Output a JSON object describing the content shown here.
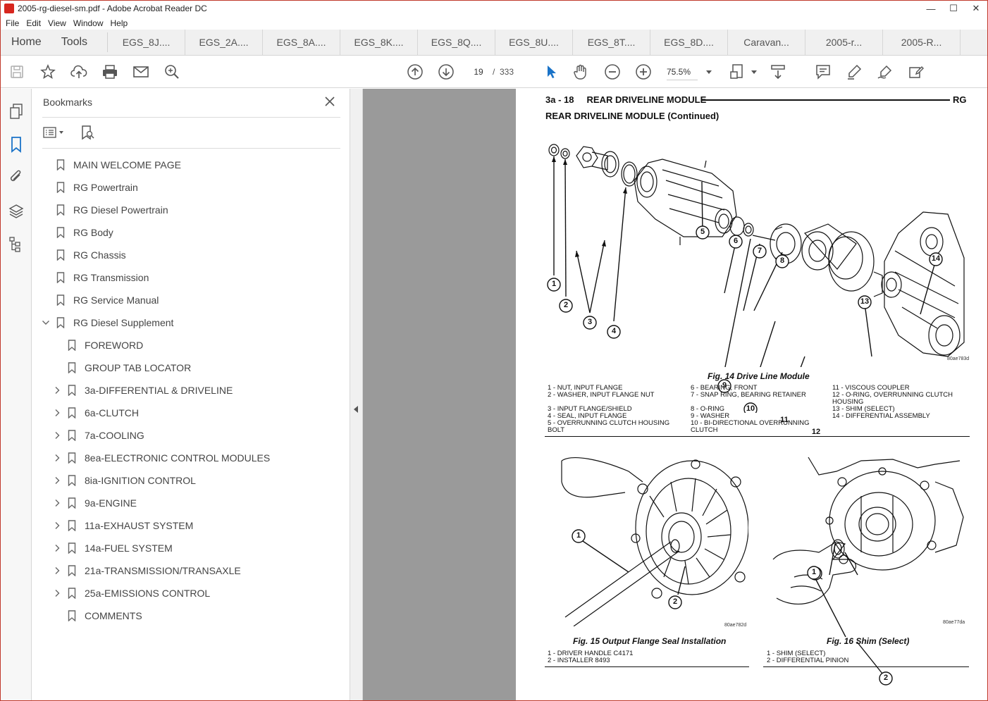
{
  "window": {
    "title": "2005-rg-diesel-sm.pdf - Adobe Acrobat Reader DC",
    "controls": {
      "minimize": "—",
      "maximize": "☐",
      "close": "✕"
    }
  },
  "menu": [
    "File",
    "Edit",
    "View",
    "Window",
    "Help"
  ],
  "tabs": {
    "home": "Home",
    "tools": "Tools",
    "documents": [
      "EGS_8J....",
      "EGS_2A....",
      "EGS_8A....",
      "EGS_8K....",
      "EGS_8Q....",
      "EGS_8U....",
      "EGS_8T....",
      "EGS_8D....",
      "Caravan...",
      "2005-r...",
      "2005-R..."
    ]
  },
  "toolbar": {
    "page_current": "19",
    "page_sep": "/",
    "page_total": "333",
    "zoom": "75.5%"
  },
  "bookmarks": {
    "title": "Bookmarks",
    "items": [
      {
        "label": "MAIN WELCOME PAGE",
        "level": 0,
        "expander": ""
      },
      {
        "label": "RG Powertrain",
        "level": 0,
        "expander": ""
      },
      {
        "label": "RG Diesel Powertrain",
        "level": 0,
        "expander": ""
      },
      {
        "label": "RG Body",
        "level": 0,
        "expander": ""
      },
      {
        "label": "RG Chassis",
        "level": 0,
        "expander": ""
      },
      {
        "label": "RG Transmission",
        "level": 0,
        "expander": ""
      },
      {
        "label": "RG Service Manual",
        "level": 0,
        "expander": ""
      },
      {
        "label": "RG Diesel Supplement",
        "level": 0,
        "expander": "open"
      },
      {
        "label": "FOREWORD",
        "level": 1,
        "expander": ""
      },
      {
        "label": "GROUP TAB LOCATOR",
        "level": 1,
        "expander": ""
      },
      {
        "label": "3a-DIFFERENTIAL & DRIVELINE",
        "level": 1,
        "expander": "closed"
      },
      {
        "label": "6a-CLUTCH",
        "level": 1,
        "expander": "closed"
      },
      {
        "label": "7a-COOLING",
        "level": 1,
        "expander": "closed"
      },
      {
        "label": "8ea-ELECTRONIC CONTROL MODULES",
        "level": 1,
        "expander": "closed"
      },
      {
        "label": "8ia-IGNITION CONTROL",
        "level": 1,
        "expander": "closed"
      },
      {
        "label": "9a-ENGINE",
        "level": 1,
        "expander": "closed"
      },
      {
        "label": "11a-EXHAUST SYSTEM",
        "level": 1,
        "expander": "closed"
      },
      {
        "label": "14a-FUEL SYSTEM",
        "level": 1,
        "expander": "closed"
      },
      {
        "label": "21a-TRANSMISSION/TRANSAXLE",
        "level": 1,
        "expander": "closed"
      },
      {
        "label": "25a-EMISSIONS CONTROL",
        "level": 1,
        "expander": "closed"
      },
      {
        "label": "COMMENTS",
        "level": 1,
        "expander": ""
      }
    ]
  },
  "page": {
    "header_left": "3a - 18     REAR DRIVELINE MODULE",
    "header_right": "RG",
    "subtitle": "REAR DRIVELINE MODULE (Continued)",
    "fig14": {
      "caption": "Fig. 14 Drive Line Module",
      "code": "80ae783d",
      "callouts": [
        "1",
        "2",
        "3",
        "4",
        "5",
        "6",
        "7",
        "8",
        "9",
        "10",
        "11",
        "12",
        "13",
        "14"
      ],
      "legend_col1": [
        "1 - NUT, INPUT FLANGE",
        "2 - WASHER, INPUT FLANGE NUT",
        "",
        "3 - INPUT FLANGE/SHIELD",
        "4 - SEAL, INPUT FLANGE",
        "5 - OVERRUNNING CLUTCH HOUSING",
        "BOLT"
      ],
      "legend_col2": [
        "6 - BEARING, FRONT",
        "7 - SNAP RING, BEARING RETAINER",
        "",
        "8 - O-RING",
        "9 - WASHER",
        "10 - BI-DIRECTIONAL OVERRUNNING",
        "CLUTCH"
      ],
      "legend_col3": [
        "11 - VISCOUS COUPLER",
        "12 - O-RING, OVERRUNNING CLUTCH",
        "HOUSING",
        "13 - SHIM (SELECT)",
        "14 - DIFFERENTIAL ASSEMBLY"
      ]
    },
    "fig15": {
      "caption": "Fig. 15 Output Flange Seal Installation",
      "code": "80ae782d",
      "callouts": [
        "1",
        "2"
      ],
      "legend": [
        "1 - DRIVER HANDLE C4171",
        "2 - INSTALLER 8493"
      ]
    },
    "fig16": {
      "caption": "Fig. 16 Shim (Select)",
      "code": "80ae77da",
      "callouts": [
        "1",
        "2"
      ],
      "legend": [
        "1 - SHIM (SELECT)",
        "2 - DIFFERENTIAL PINION"
      ]
    }
  }
}
